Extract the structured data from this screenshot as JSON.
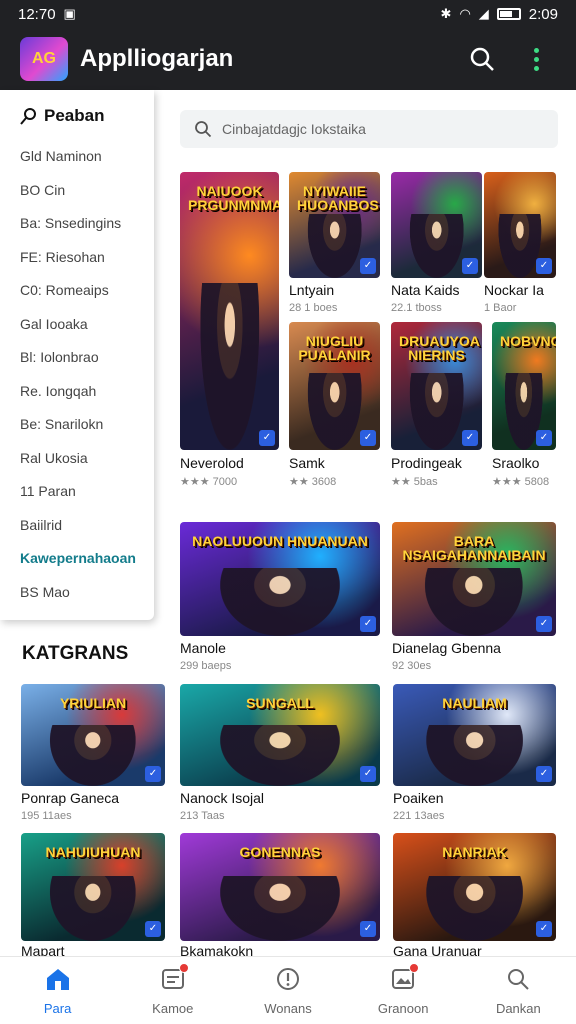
{
  "status": {
    "time": "12:70",
    "right_time": "2:09"
  },
  "app": {
    "title": "Applliogarjan",
    "logo_text": "AG"
  },
  "drawer": {
    "title": "Peaban",
    "items": [
      "Gld Naminon",
      "BO Cin",
      "Ba: Snsedingins",
      "FE: Riesohan",
      "C0: Romeaips",
      "Gal Iooaka",
      "Bl: Iolonbrao",
      "Re. Iongqah",
      "Be: Snarilokn",
      "Ral Ukosia",
      "11 Paran",
      "Baiilrid"
    ],
    "accent_item": "Kawepernahaoan",
    "last_item": "BS Mao"
  },
  "search": {
    "placeholder": "Cinbajatdagjc Iokstaika"
  },
  "featured": [
    {
      "title": "Neverolod",
      "rating": "★★★ 7000",
      "label": "NAIUOOK PRGUNMNMAS",
      "colors": [
        "#1a1a3a",
        "#c02a6a",
        "#ff8a20"
      ]
    },
    {
      "title": "Lntyain",
      "rating": "28 1 boes",
      "label": "NYIWAIIE HUOANBOS",
      "colors": [
        "#272a4a",
        "#e08a30",
        "#6b2a8a"
      ]
    },
    {
      "title": "Nata Kaids",
      "rating": "22.1 tboss",
      "label": "",
      "colors": [
        "#1c2a3a",
        "#9a2aa8",
        "#28a848"
      ]
    },
    {
      "title": "Nockar Ia",
      "rating": "1 Baor",
      "label": "",
      "colors": [
        "#2a1a18",
        "#d8601a",
        "#f0b040"
      ]
    },
    {
      "title": "Samk",
      "rating": "★★ 3608",
      "label": "NIUGLIU PUALANIR",
      "colors": [
        "#3a2a20",
        "#d88a50",
        "#a83020"
      ]
    },
    {
      "title": "Prodingeak",
      "rating": "★★ 5bas",
      "label": "DRUAUYOA NIERINS",
      "colors": [
        "#182038",
        "#b0283a",
        "#3a8ad8"
      ]
    },
    {
      "title": "Sraolko",
      "rating": "★★★ 5808",
      "label": "NOBVNGAIN",
      "colors": [
        "#103020",
        "#1a8a5a",
        "#f07a20"
      ]
    }
  ],
  "wide": [
    {
      "title": "Manole",
      "rating": "299 baeps",
      "label": "NAOLUUOUN HNUANUAN",
      "colors": [
        "#1a1a48",
        "#6a2ad8",
        "#20b0ff"
      ]
    },
    {
      "title": "Dianelag Gbenna",
      "rating": "92 30es",
      "label": "BARA NSAIGAHANNAIBAIN",
      "colors": [
        "#2a1a48",
        "#e07020",
        "#28b860"
      ]
    }
  ],
  "section": {
    "title": "KATGRANS"
  },
  "grid": [
    {
      "title": "Ponrap Ganeca",
      "rating": "195 11aes",
      "label": "YRIULIAN",
      "colors": [
        "#1a3a6a",
        "#7ab0e8",
        "#d83a3a"
      ]
    },
    {
      "title": "Nanock Isojal",
      "rating": "213 Taas",
      "label": "SUNGALL",
      "colors": [
        "#0a3a4a",
        "#1aa8a8",
        "#f0c020"
      ]
    },
    {
      "title": "Poaiken",
      "rating": "221 13aes",
      "label": "NAULIAM",
      "colors": [
        "#1a2a48",
        "#3a5ab8",
        "#e0e8f8"
      ]
    },
    {
      "title": "Mapart",
      "rating": "",
      "label": "NAHUIUHUAN",
      "colors": [
        "#0a2a30",
        "#18a088",
        "#d8402a"
      ]
    },
    {
      "title": "Bkamakokn",
      "rating": "",
      "label": "GONENNAS",
      "colors": [
        "#2a1a48",
        "#a03ad8",
        "#f07a30"
      ]
    },
    {
      "title": "Gana Uranuar",
      "rating": "",
      "label": "NANRIAK",
      "colors": [
        "#2a1810",
        "#d8501a",
        "#f0a840"
      ]
    }
  ],
  "bottom_nav": [
    {
      "label": "Para",
      "icon": "home-icon",
      "active": true,
      "dot": false
    },
    {
      "label": "Kamoe",
      "icon": "list-icon",
      "active": false,
      "dot": true
    },
    {
      "label": "Wonans",
      "icon": "alert-icon",
      "active": false,
      "dot": false
    },
    {
      "label": "Granoon",
      "icon": "image-icon",
      "active": false,
      "dot": true
    },
    {
      "label": "Dankan",
      "icon": "search-icon",
      "active": false,
      "dot": false
    }
  ],
  "colors": {
    "bar": "#202124",
    "active": "#1a73e8",
    "accent": "#137c8b",
    "star": "#f0a500"
  }
}
